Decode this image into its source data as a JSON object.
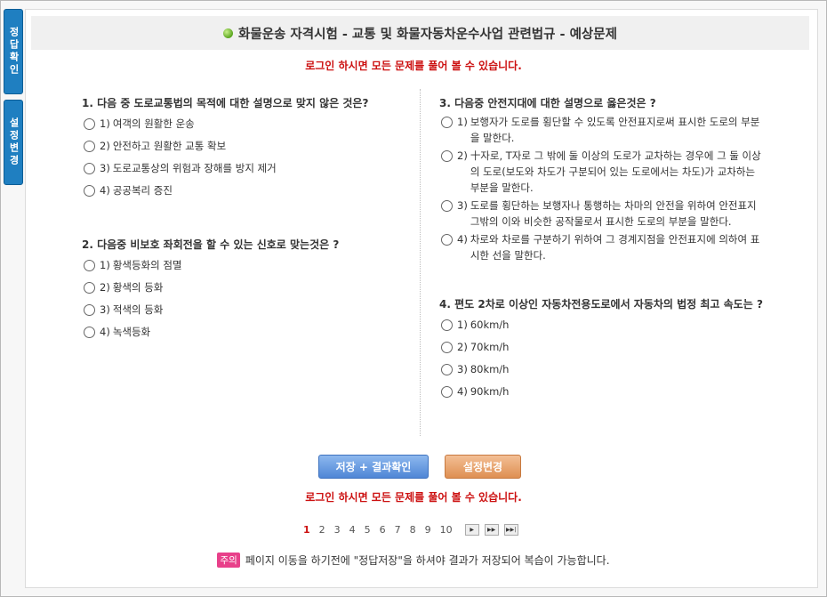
{
  "sidebar": {
    "answer_tab": "정답확인",
    "settings_tab": "설정변경"
  },
  "header": {
    "title": "화물운송 자격시험 - 교통 및 화물자동차운수사업 관련법규 - 예상문제"
  },
  "notice": "로그인 하시면 모든 문제를 풀어 볼 수 있습니다.",
  "questions": [
    {
      "title": "1. 다음 중 도로교통법의 목적에 대한 설명으로 맞지 않은 것은?",
      "options": [
        {
          "num": "1)",
          "text": "여객의 원활한 운송"
        },
        {
          "num": "2)",
          "text": "안전하고 원활한 교통 확보"
        },
        {
          "num": "3)",
          "text": "도로교통상의 위험과 장해를 방지 제거"
        },
        {
          "num": "4)",
          "text": "공공복리 증진"
        }
      ]
    },
    {
      "title": "2. 다음중 비보호 좌회전을 할 수 있는 신호로 맞는것은 ?",
      "options": [
        {
          "num": "1)",
          "text": "황색등화의 점멸"
        },
        {
          "num": "2)",
          "text": "황색의 등화"
        },
        {
          "num": "3)",
          "text": "적색의 등화"
        },
        {
          "num": "4)",
          "text": "녹색등화"
        }
      ]
    },
    {
      "title": "3. 다음중 안전지대에 대한 설명으로 옳은것은 ?",
      "options": [
        {
          "num": "1)",
          "text": "보행자가 도로를 횡단할 수 있도록 안전표지로써 표시한 도로의 부분을 말한다."
        },
        {
          "num": "2)",
          "text": "十자로, T자로 그 밖에 둘 이상의 도로가 교차하는 경우에 그 둘 이상의 도로(보도와 차도가 구분되어 있는 도로에서는 차도)가 교차하는 부분을 말한다."
        },
        {
          "num": "3)",
          "text": "도로를 횡단하는 보행자나 통행하는 차마의 안전을 위하여 안전표지 그밖의 이와 비슷한 공작물로서 표시한 도로의 부분을 말한다."
        },
        {
          "num": "4)",
          "text": "차로와 차로를 구분하기 위하여 그 경계지점을 안전표지에 의하여 표시한 선을 말한다."
        }
      ]
    },
    {
      "title": "4. 편도 2차로 이상인 자동차전용도로에서 자동차의 법정 최고 속도는 ?",
      "options": [
        {
          "num": "1)",
          "text": "60km/h"
        },
        {
          "num": "2)",
          "text": "70km/h"
        },
        {
          "num": "3)",
          "text": "80km/h"
        },
        {
          "num": "4)",
          "text": "90km/h"
        }
      ]
    }
  ],
  "buttons": {
    "save": "저장 + 결과확인",
    "settings": "설정변경"
  },
  "pagination": {
    "pages": [
      "1",
      "2",
      "3",
      "4",
      "5",
      "6",
      "7",
      "8",
      "9",
      "10"
    ],
    "current": "1",
    "next_symbol": "▶",
    "next10_symbol": "▶▶",
    "last_symbol": "▶▶|"
  },
  "footer": {
    "badge": "주의",
    "text": "페이지 이동을 하기전에 \"정답저장\"을 하셔야 결과가 저장되어 복습이 가능합니다."
  }
}
